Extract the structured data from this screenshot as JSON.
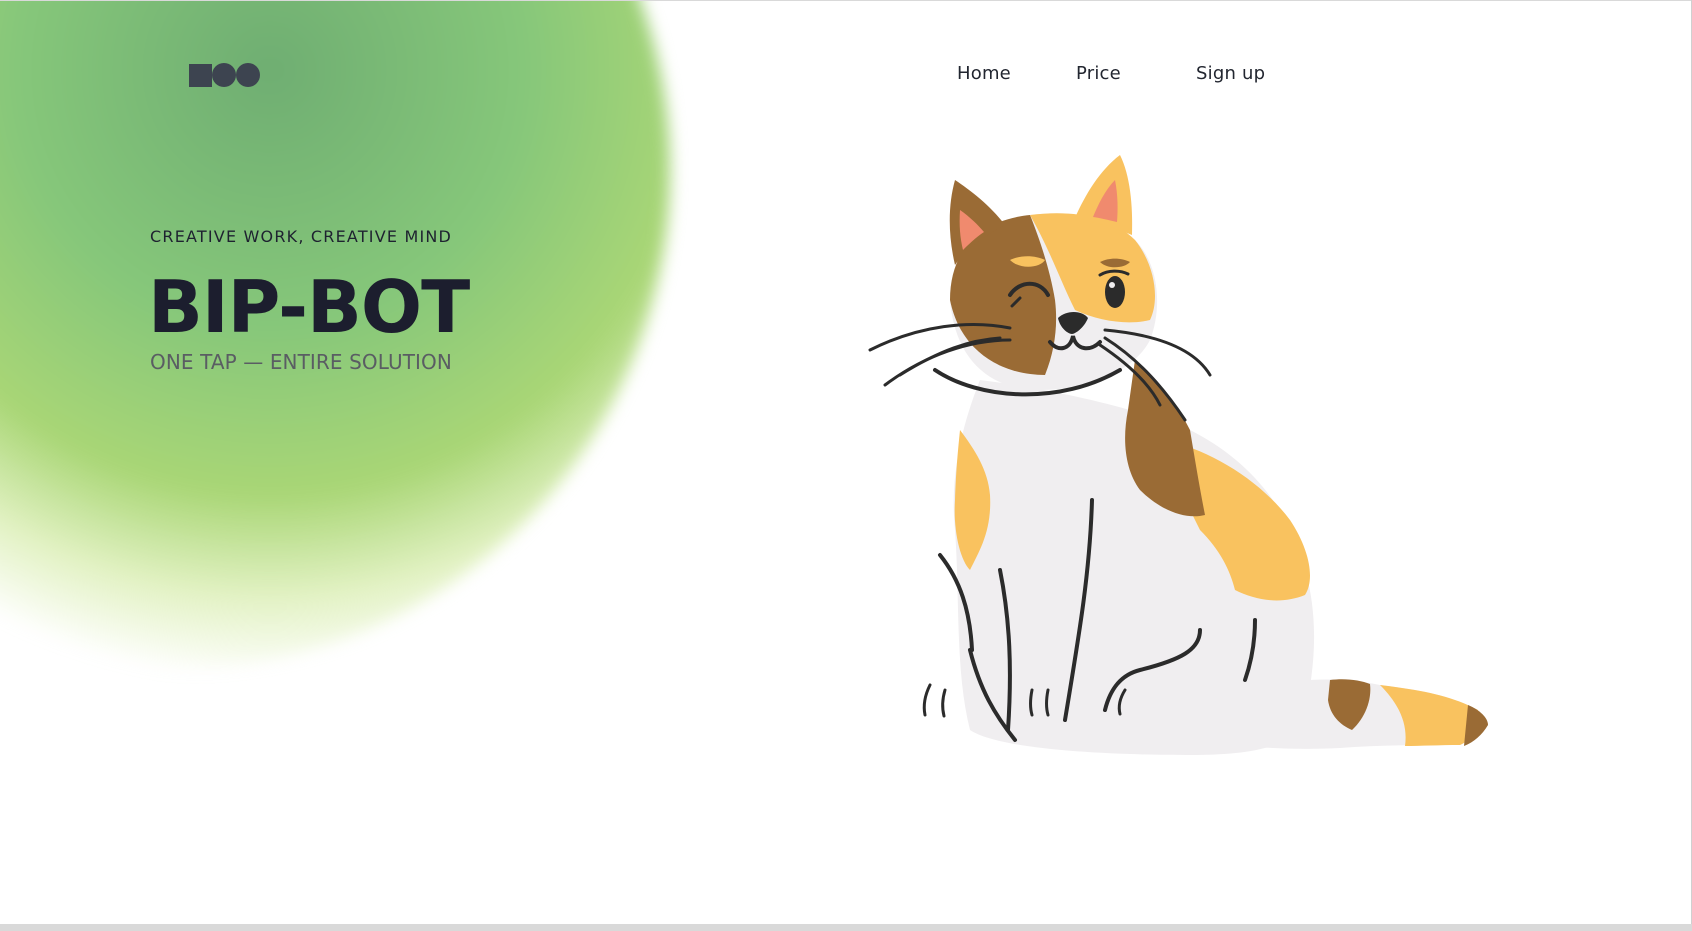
{
  "nav": {
    "home_label": "Home",
    "price_label": "Price",
    "signup_label": "Sign up"
  },
  "hero": {
    "tagline": "CREATIVE WORK, CREATIVE MIND",
    "title": "BIP-BOT",
    "subtitle": "ONE TAP — ENTIRE SOLUTION"
  },
  "logo": {
    "icon": "square-circle-circle-logo",
    "color": "#3d4450"
  },
  "colors": {
    "accent_green": "#86c77a",
    "headline": "#1c1e2e",
    "cat_orange": "#f9c25f",
    "cat_brown": "#9a6b35",
    "cat_white": "#f0eef0"
  },
  "illustration": {
    "icon": "calico-cat-illustration"
  }
}
